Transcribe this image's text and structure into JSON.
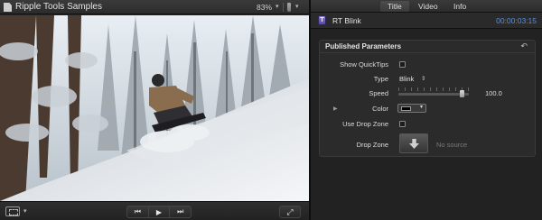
{
  "viewer": {
    "title": "Ripple Tools Samples",
    "zoom": "83%",
    "zoom_caret": "▾",
    "view_caret": "▾",
    "footer": {
      "crop_caret": "▾",
      "prev_icon": "⏮",
      "play_icon": "▶",
      "next_icon": "⏭",
      "fullscreen_icon": "⤢"
    }
  },
  "inspector": {
    "tabs": [
      {
        "label": "Title",
        "active": true
      },
      {
        "label": "Video",
        "active": false
      },
      {
        "label": "Info",
        "active": false
      }
    ],
    "clip": {
      "icon_letter": "T",
      "name": "RT Blink",
      "duration": "00:00:03:15"
    },
    "published_parameters": {
      "title": "Published Parameters",
      "reset_icon": "↶",
      "rows": {
        "show_quicktips": {
          "label": "Show QuickTips",
          "checked": false
        },
        "type": {
          "label": "Type",
          "value": "Blink",
          "caret": "⇕"
        },
        "speed": {
          "label": "Speed",
          "value": "100.0",
          "fraction": 0.9
        },
        "color": {
          "label": "Color",
          "value_hex": "#000000",
          "caret": "▾",
          "disclosure": "▶"
        },
        "use_drop_zone": {
          "label": "Use Drop Zone",
          "checked": false
        },
        "drop_zone": {
          "label": "Drop Zone",
          "status": "No source"
        }
      }
    }
  },
  "colors": {
    "accent_timecode": "#5d8fd6",
    "clip_icon": "#6a5cc4"
  }
}
